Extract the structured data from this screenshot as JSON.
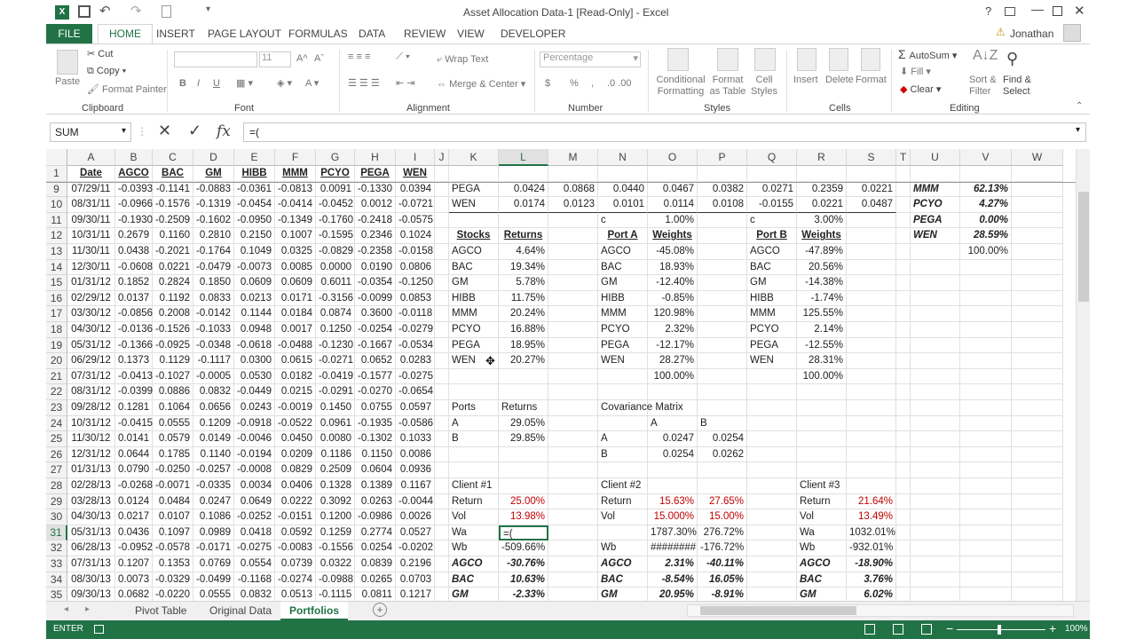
{
  "app": {
    "title": "Asset Allocation Data-1  [Read-Only] - Excel",
    "user": "Jonathan",
    "icon_names": [
      "excel-icon",
      "save-icon",
      "undo-icon",
      "redo-icon",
      "new-icon",
      "customize-icon"
    ]
  },
  "tabs": [
    "FILE",
    "HOME",
    "INSERT",
    "PAGE LAYOUT",
    "FORMULAS",
    "DATA",
    "REVIEW",
    "VIEW",
    "DEVELOPER"
  ],
  "ribbon": {
    "clipboard": {
      "paste": "Paste",
      "cut": "Cut",
      "copy": "Copy",
      "painter": "Format Painter",
      "label": "Clipboard"
    },
    "font": {
      "size": "11",
      "label": "Font",
      "bold": "B",
      "italic": "I",
      "underline": "U"
    },
    "alignment": {
      "wrap": "Wrap Text",
      "merge": "Merge & Center",
      "label": "Alignment"
    },
    "number": {
      "format": "Percentage",
      "label": "Number",
      "currency": "$",
      "pct": "%",
      "comma": ","
    },
    "styles": {
      "cond": "Conditional Formatting",
      "table": "Format as Table",
      "cell": "Cell Styles",
      "label": "Styles"
    },
    "cells": {
      "insert": "Insert",
      "delete": "Delete",
      "format": "Format",
      "label": "Cells"
    },
    "editing": {
      "autosum": "AutoSum",
      "fill": "Fill",
      "clear": "Clear",
      "sort": "Sort & Filter",
      "find": "Find & Select",
      "label": "Editing"
    }
  },
  "formula_bar": {
    "name_box": "SUM",
    "formula": "=("
  },
  "columns": [
    "A",
    "B",
    "C",
    "D",
    "E",
    "F",
    "G",
    "H",
    "I",
    "J",
    "K",
    "L",
    "M",
    "N",
    "O",
    "P",
    "Q",
    "R",
    "S",
    "T",
    "U",
    "V",
    "W"
  ],
  "rows": [
    1,
    9,
    10,
    11,
    12,
    13,
    14,
    15,
    16,
    17,
    18,
    19,
    20,
    21,
    22,
    23,
    24,
    25,
    26,
    27,
    28,
    29,
    30,
    31,
    32,
    33,
    34,
    35
  ],
  "headers": [
    "Date",
    "AGCO",
    "BAC",
    "GM",
    "HIBB",
    "MMM",
    "PCYO",
    "PEGA",
    "WEN"
  ],
  "data": [
    [
      "07/29/11",
      "-0.0393",
      "-0.1141",
      "-0.0883",
      "-0.0361",
      "-0.0813",
      "0.0091",
      "-0.1330",
      "0.0394"
    ],
    [
      "08/31/11",
      "-0.0966",
      "-0.1576",
      "-0.1319",
      "-0.0454",
      "-0.0414",
      "-0.0452",
      "0.0012",
      "-0.0721"
    ],
    [
      "09/30/11",
      "-0.1930",
      "-0.2509",
      "-0.1602",
      "-0.0950",
      "-0.1349",
      "-0.1760",
      "-0.2418",
      "-0.0575"
    ],
    [
      "10/31/11",
      "0.2679",
      "0.1160",
      "0.2810",
      "0.2150",
      "0.1007",
      "-0.1595",
      "0.2346",
      "0.1024"
    ],
    [
      "11/30/11",
      "0.0438",
      "-0.2021",
      "-0.1764",
      "0.1049",
      "0.0325",
      "-0.0829",
      "-0.2358",
      "-0.0158"
    ],
    [
      "12/30/11",
      "-0.0608",
      "0.0221",
      "-0.0479",
      "-0.0073",
      "0.0085",
      "0.0000",
      "0.0190",
      "0.0806"
    ],
    [
      "01/31/12",
      "0.1852",
      "0.2824",
      "0.1850",
      "0.0609",
      "0.0609",
      "0.6011",
      "-0.0354",
      "-0.1250"
    ],
    [
      "02/29/12",
      "0.0137",
      "0.1192",
      "0.0833",
      "0.0213",
      "0.0171",
      "-0.3156",
      "-0.0099",
      "0.0853"
    ],
    [
      "03/30/12",
      "-0.0856",
      "0.2008",
      "-0.0142",
      "0.1144",
      "0.0184",
      "0.0874",
      "0.3600",
      "-0.0118"
    ],
    [
      "04/30/12",
      "-0.0136",
      "-0.1526",
      "-0.1033",
      "0.0948",
      "0.0017",
      "0.1250",
      "-0.0254",
      "-0.0279"
    ],
    [
      "05/31/12",
      "-0.1366",
      "-0.0925",
      "-0.0348",
      "-0.0618",
      "-0.0488",
      "-0.1230",
      "-0.1667",
      "-0.0534"
    ],
    [
      "06/29/12",
      "0.1373",
      "0.1129",
      "-0.1117",
      "0.0300",
      "0.0615",
      "-0.0271",
      "0.0652",
      "0.0283"
    ],
    [
      "07/31/12",
      "-0.0413",
      "-0.1027",
      "-0.0005",
      "0.0530",
      "0.0182",
      "-0.0419",
      "-0.1577",
      "-0.0275"
    ],
    [
      "08/31/12",
      "-0.0399",
      "0.0886",
      "0.0832",
      "-0.0449",
      "0.0215",
      "-0.0291",
      "-0.0270",
      "-0.0654"
    ],
    [
      "09/28/12",
      "0.1281",
      "0.1064",
      "0.0656",
      "0.0243",
      "-0.0019",
      "0.1450",
      "0.0755",
      "0.0597"
    ],
    [
      "10/31/12",
      "-0.0415",
      "0.0555",
      "0.1209",
      "-0.0918",
      "-0.0522",
      "0.0961",
      "-0.1935",
      "-0.0586"
    ],
    [
      "11/30/12",
      "0.0141",
      "0.0579",
      "0.0149",
      "-0.0046",
      "0.0450",
      "0.0080",
      "-0.1302",
      "0.1033"
    ],
    [
      "12/31/12",
      "0.0644",
      "0.1785",
      "0.1140",
      "-0.0194",
      "0.0209",
      "0.1186",
      "0.1150",
      "0.0086"
    ],
    [
      "01/31/13",
      "0.0790",
      "-0.0250",
      "-0.0257",
      "-0.0008",
      "0.0829",
      "0.2509",
      "0.0604",
      "0.0936"
    ],
    [
      "02/28/13",
      "-0.0268",
      "-0.0071",
      "-0.0335",
      "0.0034",
      "0.0406",
      "0.1328",
      "0.1389",
      "0.1167"
    ],
    [
      "03/28/13",
      "0.0124",
      "0.0484",
      "0.0247",
      "0.0649",
      "0.0222",
      "0.3092",
      "0.0263",
      "-0.0044"
    ],
    [
      "04/30/13",
      "0.0217",
      "0.0107",
      "0.1086",
      "-0.0252",
      "-0.0151",
      "0.1200",
      "-0.0986",
      "0.0026"
    ],
    [
      "05/31/13",
      "0.0436",
      "0.1097",
      "0.0989",
      "0.0418",
      "0.0592",
      "0.1259",
      "0.2774",
      "0.0527"
    ],
    [
      "06/28/13",
      "-0.0952",
      "-0.0578",
      "-0.0171",
      "-0.0275",
      "-0.0083",
      "-0.1556",
      "0.0254",
      "-0.0202"
    ],
    [
      "07/31/13",
      "0.1207",
      "0.1353",
      "0.0769",
      "0.0554",
      "0.0739",
      "0.0322",
      "0.0839",
      "0.2196"
    ],
    [
      "08/30/13",
      "0.0073",
      "-0.0329",
      "-0.0499",
      "-0.1168",
      "-0.0274",
      "-0.0988",
      "0.0265",
      "0.0703"
    ],
    [
      "09/30/13",
      "0.0682",
      "-0.0220",
      "0.0555",
      "0.0832",
      "0.0513",
      "-0.1115",
      "0.0811",
      "0.1217"
    ]
  ],
  "cov_rows": [
    [
      "PEGA",
      "0.0424",
      "0.0868",
      "0.0440",
      "0.0467",
      "0.0382",
      "0.0271",
      "0.2359",
      "0.0221"
    ],
    [
      "WEN",
      "0.0174",
      "0.0123",
      "0.0101",
      "0.0114",
      "0.0108",
      "-0.0155",
      "0.0221",
      "0.0487"
    ]
  ],
  "right_panel": [
    [
      "MMM",
      "62.13%"
    ],
    [
      "PCYO",
      "4.27%"
    ],
    [
      "PEGA",
      "0.00%"
    ],
    [
      "WEN",
      "28.59%"
    ],
    [
      "",
      "100.00%"
    ]
  ],
  "stocks_hdr": [
    "Stocks",
    "Returns"
  ],
  "stocks": [
    [
      "AGCO",
      "4.64%"
    ],
    [
      "BAC",
      "19.34%"
    ],
    [
      "GM",
      "5.78%"
    ],
    [
      "HIBB",
      "11.75%"
    ],
    [
      "MMM",
      "20.24%"
    ],
    [
      "PCYO",
      "16.88%"
    ],
    [
      "PEGA",
      "18.95%"
    ],
    [
      "WEN",
      "20.27%"
    ]
  ],
  "portA": {
    "c": "c",
    "cval": "1.00%",
    "hdr": [
      "Port A",
      "Weights"
    ],
    "rows": [
      [
        "AGCO",
        "-45.08%"
      ],
      [
        "BAC",
        "18.93%"
      ],
      [
        "GM",
        "-12.40%"
      ],
      [
        "HIBB",
        "-0.85%"
      ],
      [
        "MMM",
        "120.98%"
      ],
      [
        "PCYO",
        "2.32%"
      ],
      [
        "PEGA",
        "-12.17%"
      ],
      [
        "WEN",
        "28.27%"
      ]
    ],
    "total": "100.00%"
  },
  "portB": {
    "c": "c",
    "cval": "3.00%",
    "hdr": [
      "Port B",
      "Weights"
    ],
    "rows": [
      [
        "AGCO",
        "-47.89%"
      ],
      [
        "BAC",
        "20.56%"
      ],
      [
        "GM",
        "-14.38%"
      ],
      [
        "HIBB",
        "-1.74%"
      ],
      [
        "MMM",
        "125.55%"
      ],
      [
        "PCYO",
        "2.14%"
      ],
      [
        "PEGA",
        "-12.55%"
      ],
      [
        "WEN",
        "28.31%"
      ]
    ],
    "total": "100.00%"
  },
  "ports": {
    "hdr": [
      "Ports",
      "Returns"
    ],
    "rows": [
      [
        "A",
        "29.05%"
      ],
      [
        "B",
        "29.85%"
      ]
    ]
  },
  "cov": {
    "title": "Covariance Matrix",
    "hdr": [
      "A",
      "B"
    ],
    "rows": [
      [
        "A",
        "0.0247",
        "0.0254"
      ],
      [
        "B",
        "0.0254",
        "0.0262"
      ]
    ]
  },
  "client1": {
    "title": "Client #1",
    "return": [
      "Return",
      "25.00%"
    ],
    "vol": [
      "Vol",
      "13.98%"
    ],
    "wa": [
      "Wa",
      "=("
    ],
    "wb": [
      "Wb",
      "-509.66%"
    ],
    "agco": [
      "AGCO",
      "-30.76%"
    ],
    "bac": [
      "BAC",
      "10.63%"
    ],
    "gm": [
      "GM",
      "-2.33%"
    ]
  },
  "client2": {
    "title": "Client #2",
    "return": [
      "Return",
      "15.63%",
      "27.65%"
    ],
    "vol": [
      "Vol",
      "15.000%",
      "15.00%"
    ],
    "wa": [
      "",
      "1787.30%",
      "276.72%"
    ],
    "wb": [
      "Wb",
      "########",
      "-176.72%"
    ],
    "agco": [
      "AGCO",
      "2.31%",
      "-40.11%"
    ],
    "bac": [
      "BAC",
      "-8.54%",
      "16.05%"
    ],
    "gm": [
      "GM",
      "20.95%",
      "-8.91%"
    ]
  },
  "client3": {
    "title": "Client #3",
    "return": [
      "Return",
      "21.64%"
    ],
    "vol": [
      "Vol",
      "13.49%"
    ],
    "wa": [
      "Wa",
      "1032.01%"
    ],
    "wb": [
      "Wb",
      "-932.01%"
    ],
    "agco": [
      "AGCO",
      "-18.90%"
    ],
    "bac": [
      "BAC",
      "3.76%"
    ],
    "gm": [
      "GM",
      "6.02%"
    ]
  },
  "sheets": [
    "Pivot Table",
    "Original Data",
    "Portfolios"
  ],
  "status": {
    "mode": "ENTER",
    "zoom": "100%"
  }
}
